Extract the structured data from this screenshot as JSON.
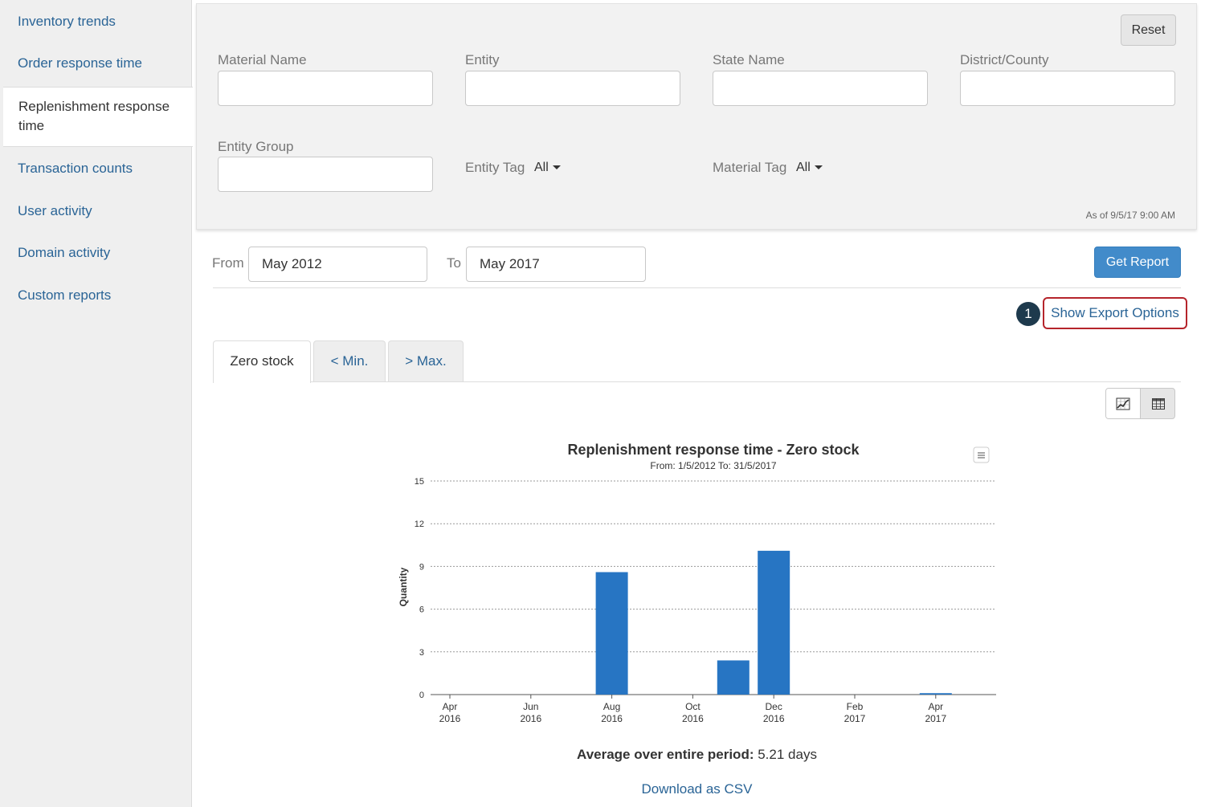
{
  "sidebar": {
    "items": [
      {
        "label": "Inventory trends",
        "name": "sidebar-item-inventory-trends"
      },
      {
        "label": "Order response time",
        "name": "sidebar-item-order-response-time"
      },
      {
        "label": "Replenishment response time",
        "name": "sidebar-item-replenishment-response-time",
        "active": true
      },
      {
        "label": "Transaction counts",
        "name": "sidebar-item-transaction-counts"
      },
      {
        "label": "User activity",
        "name": "sidebar-item-user-activity"
      },
      {
        "label": "Domain activity",
        "name": "sidebar-item-domain-activity"
      },
      {
        "label": "Custom reports",
        "name": "sidebar-item-custom-reports"
      }
    ]
  },
  "filters": {
    "reset_label": "Reset",
    "material_name_label": "Material Name",
    "entity_label": "Entity",
    "state_name_label": "State Name",
    "district_county_label": "District/County",
    "entity_group_label": "Entity Group",
    "entity_tag_label": "Entity Tag",
    "entity_tag_value": "All",
    "material_tag_label": "Material Tag",
    "material_tag_value": "All",
    "as_of": "As of 9/5/17 9:00 AM"
  },
  "date_range": {
    "from_label": "From",
    "from_value": "May 2012",
    "to_label": "To",
    "to_value": "May 2017",
    "get_report_label": "Get Report"
  },
  "export": {
    "step_number": "1",
    "link_label": "Show Export Options"
  },
  "tabs": [
    {
      "label": "Zero stock",
      "active": true
    },
    {
      "label": "< Min.",
      "active": false
    },
    {
      "label": "> Max.",
      "active": false
    }
  ],
  "view_toggle": {
    "chart_icon": "chart-icon",
    "table_icon": "table-icon"
  },
  "chart_data": {
    "type": "bar",
    "title": "Replenishment response time - Zero stock",
    "subtitle": "From: 1/5/2012 To: 31/5/2017",
    "ylabel": "Quantity",
    "xlabel": "",
    "ylim": [
      0,
      15
    ],
    "yticks": [
      0,
      3,
      6,
      9,
      12,
      15
    ],
    "grid": true,
    "bar_color": "#2775c3",
    "x_tick_labels": [
      {
        "month": "Apr",
        "year": "2016"
      },
      {
        "month": "Jun",
        "year": "2016"
      },
      {
        "month": "Aug",
        "year": "2016"
      },
      {
        "month": "Oct",
        "year": "2016"
      },
      {
        "month": "Dec",
        "year": "2016"
      },
      {
        "month": "Feb",
        "year": "2017"
      },
      {
        "month": "Apr",
        "year": "2017"
      }
    ],
    "categories": [
      "Apr 2016",
      "May 2016",
      "Jun 2016",
      "Jul 2016",
      "Aug 2016",
      "Sep 2016",
      "Oct 2016",
      "Nov 2016",
      "Dec 2016",
      "Jan 2017",
      "Feb 2017",
      "Mar 2017",
      "Apr 2017"
    ],
    "values": [
      0,
      0,
      0,
      0,
      8.6,
      0,
      0,
      2.4,
      10.1,
      0,
      0,
      0,
      0.1
    ]
  },
  "summary": {
    "avg_label": "Average over entire period:",
    "avg_value": " 5.21 days",
    "download_label": "Download as CSV"
  }
}
